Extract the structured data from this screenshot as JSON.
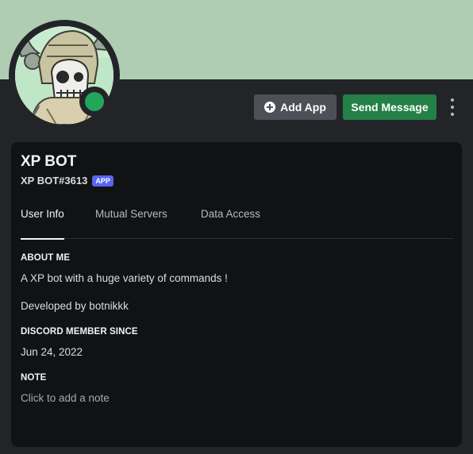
{
  "banner": {
    "color": "#aecdb3"
  },
  "avatar": {
    "status": "online",
    "status_color": "#23a55a",
    "icon": "skull-viking-avatar"
  },
  "actions": {
    "add_app_label": "Add App",
    "send_message_label": "Send Message",
    "more_icon": "vertical-ellipsis-icon"
  },
  "profile": {
    "display_name": "XP BOT",
    "username": "XP BOT#3613",
    "badge": "APP"
  },
  "tabs": [
    {
      "label": "User Info",
      "active": true
    },
    {
      "label": "Mutual Servers",
      "active": false
    },
    {
      "label": "Data Access",
      "active": false
    }
  ],
  "about": {
    "title": "ABOUT ME",
    "line1": "A XP bot with a huge variety of commands !",
    "line2": "Developed by botnikkk"
  },
  "member_since": {
    "title": "DISCORD MEMBER SINCE",
    "date": "Jun 24, 2022"
  },
  "note": {
    "title": "NOTE",
    "placeholder": "Click to add a note"
  }
}
